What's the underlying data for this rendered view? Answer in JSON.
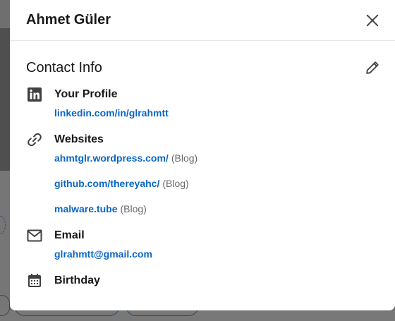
{
  "modal": {
    "title": "Ahmet Güler",
    "close_icon": "close-icon"
  },
  "contact": {
    "section_title": "Contact Info",
    "edit_icon": "pencil-icon",
    "profile": {
      "label": "Your Profile",
      "icon": "linkedin-icon",
      "url": "linkedin.com/in/glrahmtt"
    },
    "websites": {
      "label": "Websites",
      "icon": "link-icon",
      "items": [
        {
          "url": "ahmtglr.wordpress.com/",
          "type": "(Blog)"
        },
        {
          "url": "github.com/thereyahc/",
          "type": "(Blog)"
        },
        {
          "url": "malware.tube",
          "type": "(Blog)"
        }
      ]
    },
    "email": {
      "label": "Email",
      "icon": "envelope-icon",
      "value": "glrahmtt@gmail.com"
    },
    "birthday": {
      "label": "Birthday",
      "icon": "calendar-icon"
    }
  },
  "colors": {
    "link": "#0a66c2",
    "text": "#191919",
    "muted": "#666666"
  }
}
